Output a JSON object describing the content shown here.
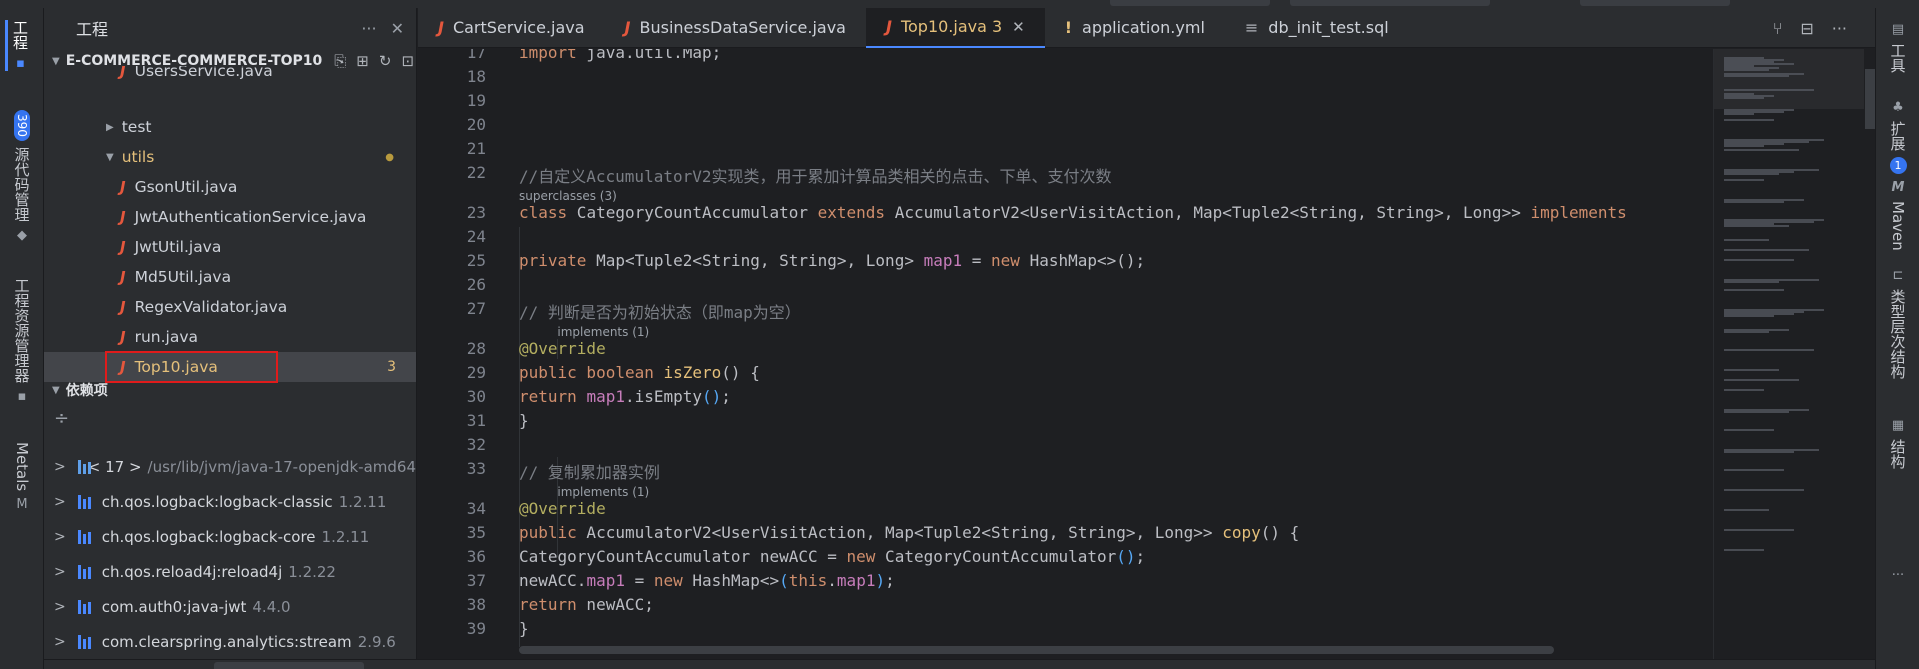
{
  "left_bar": {
    "items": [
      {
        "label": "工程",
        "icon": "folder-icon"
      },
      {
        "label": "源代码管理",
        "badge": "390",
        "icon": "git-icon"
      },
      {
        "label": "工程资源管理器",
        "icon": "explorer-icon"
      },
      {
        "label": "Metals",
        "icon": "metals-icon"
      }
    ]
  },
  "right_bar": {
    "items": [
      {
        "label": "工具",
        "icon": "tools-icon"
      },
      {
        "label": "扩展",
        "badge": "1",
        "icon": "extensions-icon"
      },
      {
        "label": "Maven",
        "icon": "maven-icon"
      },
      {
        "label": "类型层次结构",
        "icon": "hierarchy-icon"
      },
      {
        "label": "结构",
        "icon": "structure-icon"
      }
    ]
  },
  "project_panel": {
    "title": "工程",
    "more": "···",
    "close": "✕",
    "root": "E-COMMERCE-COMMERCE-TOP10",
    "tree": [
      {
        "label": "UsersService.java",
        "type": "java",
        "indent": 2
      },
      {
        "label": "test",
        "type": "folder-collapsed",
        "indent": 1
      },
      {
        "label": "utils",
        "type": "folder-open",
        "indent": 1,
        "modified": "●"
      },
      {
        "label": "GsonUtil.java",
        "type": "java",
        "indent": 2
      },
      {
        "label": "JwtAuthenticationService.java",
        "type": "java",
        "indent": 2
      },
      {
        "label": "JwtUtil.java",
        "type": "java",
        "indent": 2
      },
      {
        "label": "Md5Util.java",
        "type": "java",
        "indent": 2
      },
      {
        "label": "RegexValidator.java",
        "type": "java",
        "indent": 2
      },
      {
        "label": "run.java",
        "type": "java",
        "indent": 2
      },
      {
        "label": "Top10.java",
        "type": "java",
        "indent": 2,
        "selected": true,
        "errors": "3"
      }
    ],
    "deps_title": "依赖项",
    "deps": [
      {
        "name": "< 17 >",
        "detail": "/usr/lib/jvm/java-17-openjdk-amd64",
        "kind": "jdk"
      },
      {
        "name": "ch.qos.logback:logback-classic",
        "detail": "1.2.11",
        "kind": "lib"
      },
      {
        "name": "ch.qos.logback:logback-core",
        "detail": "1.2.11",
        "kind": "lib"
      },
      {
        "name": "ch.qos.reload4j:reload4j",
        "detail": "1.2.22",
        "kind": "lib"
      },
      {
        "name": "com.auth0:java-jwt",
        "detail": "4.4.0",
        "kind": "lib"
      },
      {
        "name": "com.clearspring.analytics:stream",
        "detail": "2.9.6",
        "kind": "lib"
      }
    ]
  },
  "tabs": [
    {
      "label": "CartService.java",
      "icon": "java"
    },
    {
      "label": "BusinessDataService.java",
      "icon": "java"
    },
    {
      "label": "Top10.java 3",
      "icon": "java",
      "active": true,
      "close": "✕"
    },
    {
      "label": "application.yml",
      "icon": "yml"
    },
    {
      "label": "db_init_test.sql",
      "icon": "db"
    }
  ],
  "tab_actions": {
    "branch": "⑂",
    "split": "⊟",
    "more": "···"
  },
  "editor": {
    "lines": [
      {
        "n": "17",
        "html": "<span class=\"kw\">import</span> java.util.Map;"
      },
      {
        "n": "18",
        "html": ""
      },
      {
        "n": "19",
        "html": ""
      },
      {
        "n": "20",
        "html": ""
      },
      {
        "n": "21",
        "html": ""
      },
      {
        "n": "22",
        "html": "<span class=\"cm\">//自定义AccumulatorV2实现类，用于累加计算品类相关的点击、下单、支付次数</span>"
      },
      {
        "hint": "superclasses (3)"
      },
      {
        "n": "23",
        "html": "<span class=\"kw\">class</span> CategoryCountAccumulator <span class=\"kw\">extends</span> AccumulatorV2&lt;UserVisitAction, Map&lt;Tuple2&lt;String, String&gt;, Long&gt;&gt; <span class=\"kw\">implements</span>"
      },
      {
        "n": "24",
        "html": ""
      },
      {
        "n": "25",
        "html": "    <span class=\"kw\">private</span> Map&lt;Tuple2&lt;String, String&gt;, Long&gt; <span class=\"fld\">map1</span> = <span class=\"kw\">new</span> HashMap&lt;&gt;();"
      },
      {
        "n": "26",
        "html": ""
      },
      {
        "n": "27",
        "html": "    <span class=\"cm\">// 判断是否为初始状态（即map为空）</span>"
      },
      {
        "hint": "implements (1)",
        "indent": 4
      },
      {
        "n": "28",
        "html": "    <span class=\"an\">@Override</span>"
      },
      {
        "n": "29",
        "html": "    <span class=\"kw\">public boolean</span> <span class=\"fn\">isZero</span>() {"
      },
      {
        "n": "30",
        "html": "        <span class=\"kw\">return</span> <span class=\"fld\">map1</span>.isEmpty<span class=\"par\">()</span>;"
      },
      {
        "n": "31",
        "html": "    }"
      },
      {
        "n": "32",
        "html": ""
      },
      {
        "n": "33",
        "html": "    <span class=\"cm\">// 复制累加器实例</span>"
      },
      {
        "hint": "implements (1)",
        "indent": 4
      },
      {
        "n": "34",
        "html": "    <span class=\"an\">@Override</span>"
      },
      {
        "n": "35",
        "html": "    <span class=\"kw\">public</span> AccumulatorV2&lt;UserVisitAction, Map&lt;Tuple2&lt;String, String&gt;, Long&gt;&gt; <span class=\"fn\">copy</span>() {"
      },
      {
        "n": "36",
        "html": "        CategoryCountAccumulator newACC = <span class=\"kw\">new</span> CategoryCountAccumulator<span class=\"par\">()</span>;"
      },
      {
        "n": "37",
        "html": "        newACC.<span class=\"fld\">map1</span> = <span class=\"kw\">new</span> HashMap&lt;&gt;<span class=\"par\">(</span><span class=\"kw\">this</span>.<span class=\"fld\">map1</span><span class=\"par\">)</span>;"
      },
      {
        "n": "38",
        "html": "        <span class=\"kw\">return</span> newACC;"
      },
      {
        "n": "39",
        "html": "    }"
      }
    ]
  }
}
